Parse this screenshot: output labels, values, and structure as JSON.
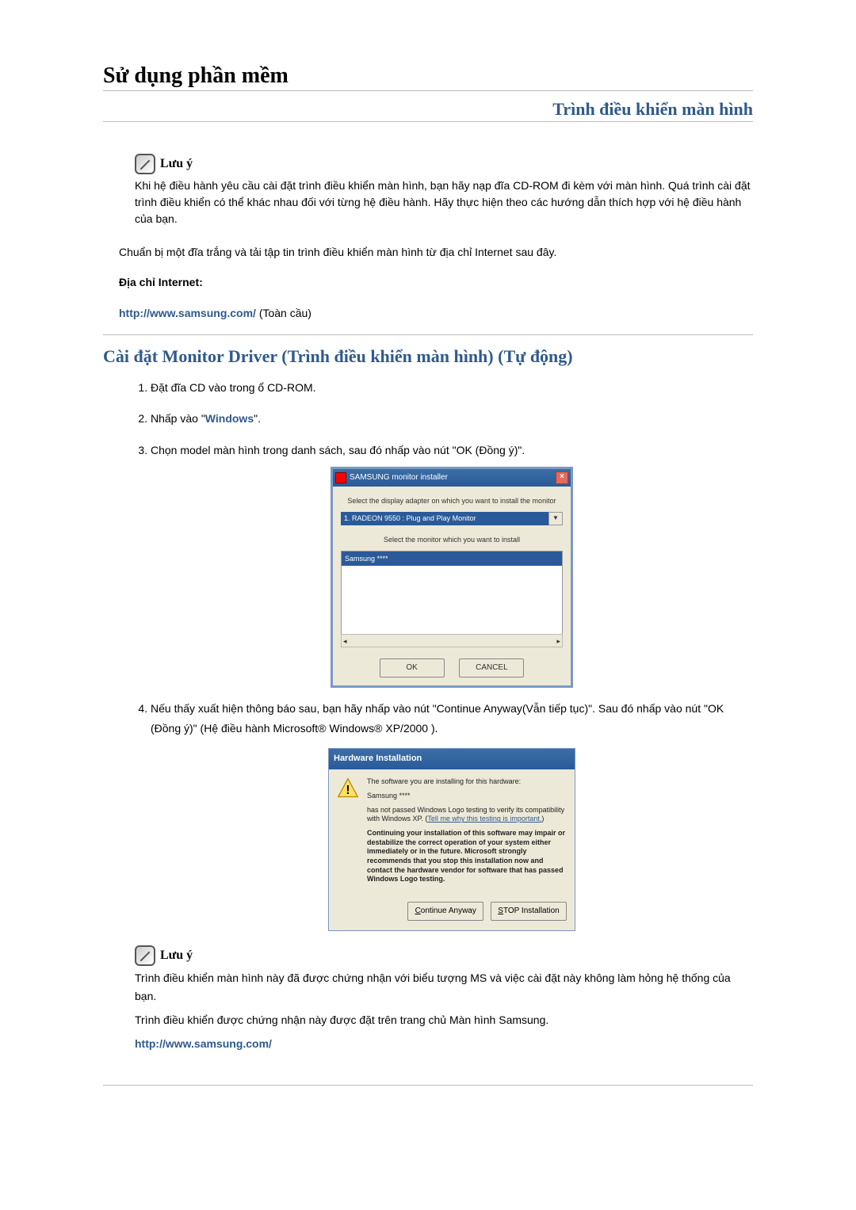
{
  "page": {
    "title": "Sử dụng phần mềm",
    "subtitle": "Trình điều khiển màn hình"
  },
  "note1": {
    "label": "Lưu ý",
    "body": "Khi hệ điều hành yêu cầu cài đặt trình điều khiển màn hình, bạn hãy nạp đĩa CD-ROM đi kèm với màn hình. Quá trình cài đặt trình điều khiển có thể khác nhau đối với từng hệ điều hành. Hãy thực hiện theo các hướng dẫn thích hợp với hệ điều hành của bạn."
  },
  "prep": "Chuẩn bị một đĩa trắng và tải tập tin trình điều khiển màn hình từ địa chỉ Internet sau đây.",
  "internet_label": "Địa chỉ Internet:",
  "url": "http://www.samsung.com/",
  "url_suffix": " (Toàn cầu)",
  "section2_title": "Cài đặt Monitor Driver (Trình điều khiển màn hình) (Tự động)",
  "steps": [
    "Đặt đĩa CD vào trong ổ CD-ROM.",
    {
      "prefix": "Nhấp vào \"",
      "link": "Windows",
      "suffix": "\"."
    },
    "Chọn model màn hình trong danh sách, sau đó nhấp vào nút \"OK (Đồng ý)\".",
    "Nếu thấy xuất hiện thông báo sau, bạn hãy nhấp vào nút \"Continue Anyway(Vẫn tiếp tục)\". Sau đó nhấp vào nút \"OK (Đồng ý)\" (Hệ điều hành Microsoft® Windows® XP/2000 )."
  ],
  "installer": {
    "title": "SAMSUNG monitor installer",
    "line1": "Select the display adapter on which you want to install the monitor",
    "dropdown": "1. RADEON 9550 : Plug and Play Monitor",
    "line2": "Select the monitor which you want to install",
    "list_sel": "Samsung ****",
    "ok": "OK",
    "cancel": "CANCEL"
  },
  "hw": {
    "title": "Hardware Installation",
    "l1": "The software you are installing for this hardware:",
    "l2": "Samsung ****",
    "l3a": "has not passed Windows Logo testing to verify its compatibility with Windows XP. (",
    "l3link": "Tell me why this testing is important.",
    "l3b": ")",
    "l4": "Continuing your installation of this software may impair or destabilize the correct operation of your system either immediately or in the future. Microsoft strongly recommends that you stop this installation now and contact the hardware vendor for software that has passed Windows Logo testing.",
    "btn_continue": "Continue Anyway",
    "btn_stop": "STOP Installation"
  },
  "note2": {
    "label": "Lưu ý",
    "l1": "Trình điều khiển màn hình này đã được chứng nhận với biểu tượng MS và việc cài đặt này không làm hỏng hệ thống của bạn.",
    "l2": "Trình điều khiển được chứng nhận này được đặt trên trang chủ Màn hình Samsung.",
    "url": "http://www.samsung.com/"
  }
}
